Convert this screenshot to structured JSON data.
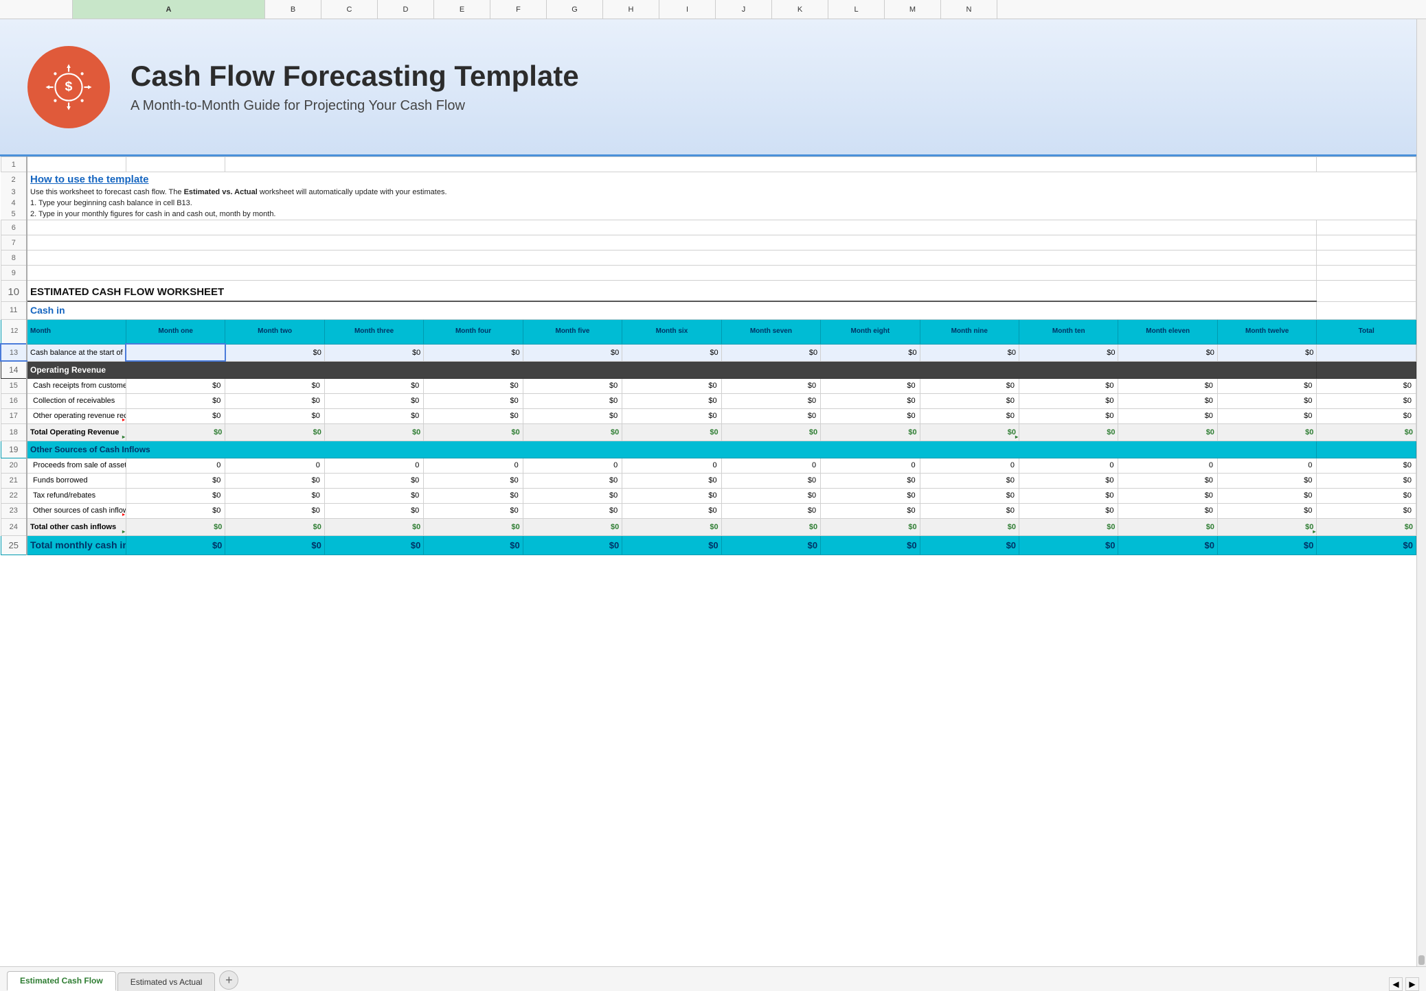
{
  "app": {
    "title": "Cash Flow Forecasting Template"
  },
  "banner": {
    "title": "Cash Flow Forecasting Template",
    "subtitle": "A Month-to-Month Guide for Projecting Your Cash Flow"
  },
  "how_to": {
    "heading": "How to use the template",
    "line1": "Use this worksheet to forecast cash flow. The",
    "bold1": "Estimated vs. Actual",
    "line1b": "worksheet will automatically update with your estimates.",
    "line2": "1. Type your beginning cash balance in cell B13.",
    "line3": "2. Type in your monthly figures for cash in and cash out, month by month."
  },
  "section_title": "ESTIMATED CASH FLOW WORKSHEET",
  "section_cash_in": "Cash in",
  "months": {
    "header": "Month",
    "cols": [
      "Month one",
      "Month two",
      "Month three",
      "Month four",
      "Month five",
      "Month six",
      "Month seven",
      "Month eight",
      "Month nine",
      "Month ten",
      "Month eleven",
      "Month twelve",
      "Total"
    ]
  },
  "rows": {
    "cash_balance": "Cash balance at the start of each month",
    "operating_revenue": "Operating Revenue",
    "cash_receipts": "Cash receipts from customers",
    "collection_receivables": "Collection of receivables",
    "other_operating": "Other operating revenue received",
    "total_operating": "Total Operating Revenue",
    "other_sources": "Other Sources of Cash Inflows",
    "proceeds_sale": "Proceeds from sale of assets",
    "funds_borrowed": "Funds borrowed",
    "tax_refund": "Tax refund/rebates",
    "other_inflow": "Other sources of cash inflow",
    "total_other": "Total other cash inflows",
    "total_monthly": "Total monthly cash in"
  },
  "zero_dollar": "$0",
  "zero": "0",
  "tabs": {
    "active": "Estimated Cash Flow",
    "inactive": "Estimated vs Actual",
    "add_label": "+"
  },
  "column_widths": {
    "a": 280,
    "month": 82
  }
}
